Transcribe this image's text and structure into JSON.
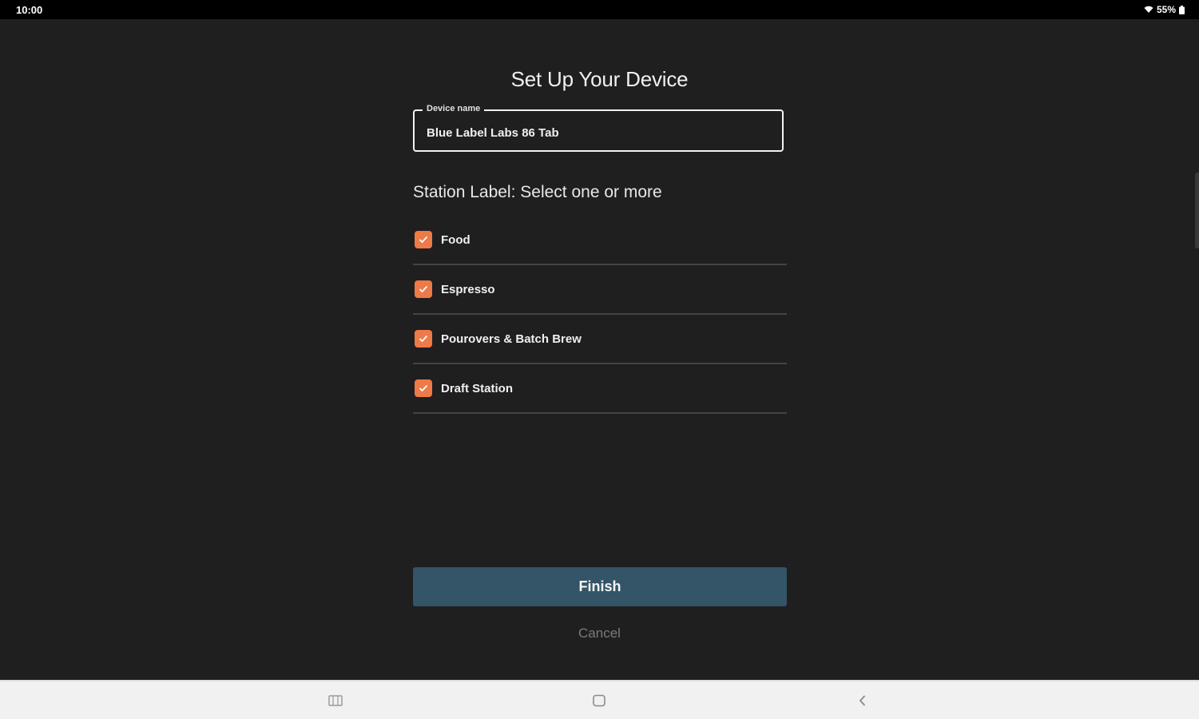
{
  "status_bar": {
    "time": "10:00",
    "battery": "55%"
  },
  "page": {
    "title": "Set Up Your Device"
  },
  "device_name": {
    "label": "Device name",
    "value": "Blue Label Labs 86 Tab"
  },
  "station": {
    "label": "Station Label: Select one or more",
    "options": [
      {
        "label": "Food",
        "checked": true
      },
      {
        "label": "Espresso",
        "checked": true
      },
      {
        "label": "Pourovers & Batch Brew",
        "checked": true
      },
      {
        "label": "Draft Station",
        "checked": true
      }
    ]
  },
  "actions": {
    "finish_label": "Finish",
    "cancel_label": "Cancel"
  },
  "colors": {
    "accent": "#ee7a48",
    "primary_button": "#345468",
    "background": "#1f1f1f"
  },
  "nav_bar": {
    "icons": [
      "recents-icon",
      "home-icon",
      "back-icon"
    ]
  }
}
